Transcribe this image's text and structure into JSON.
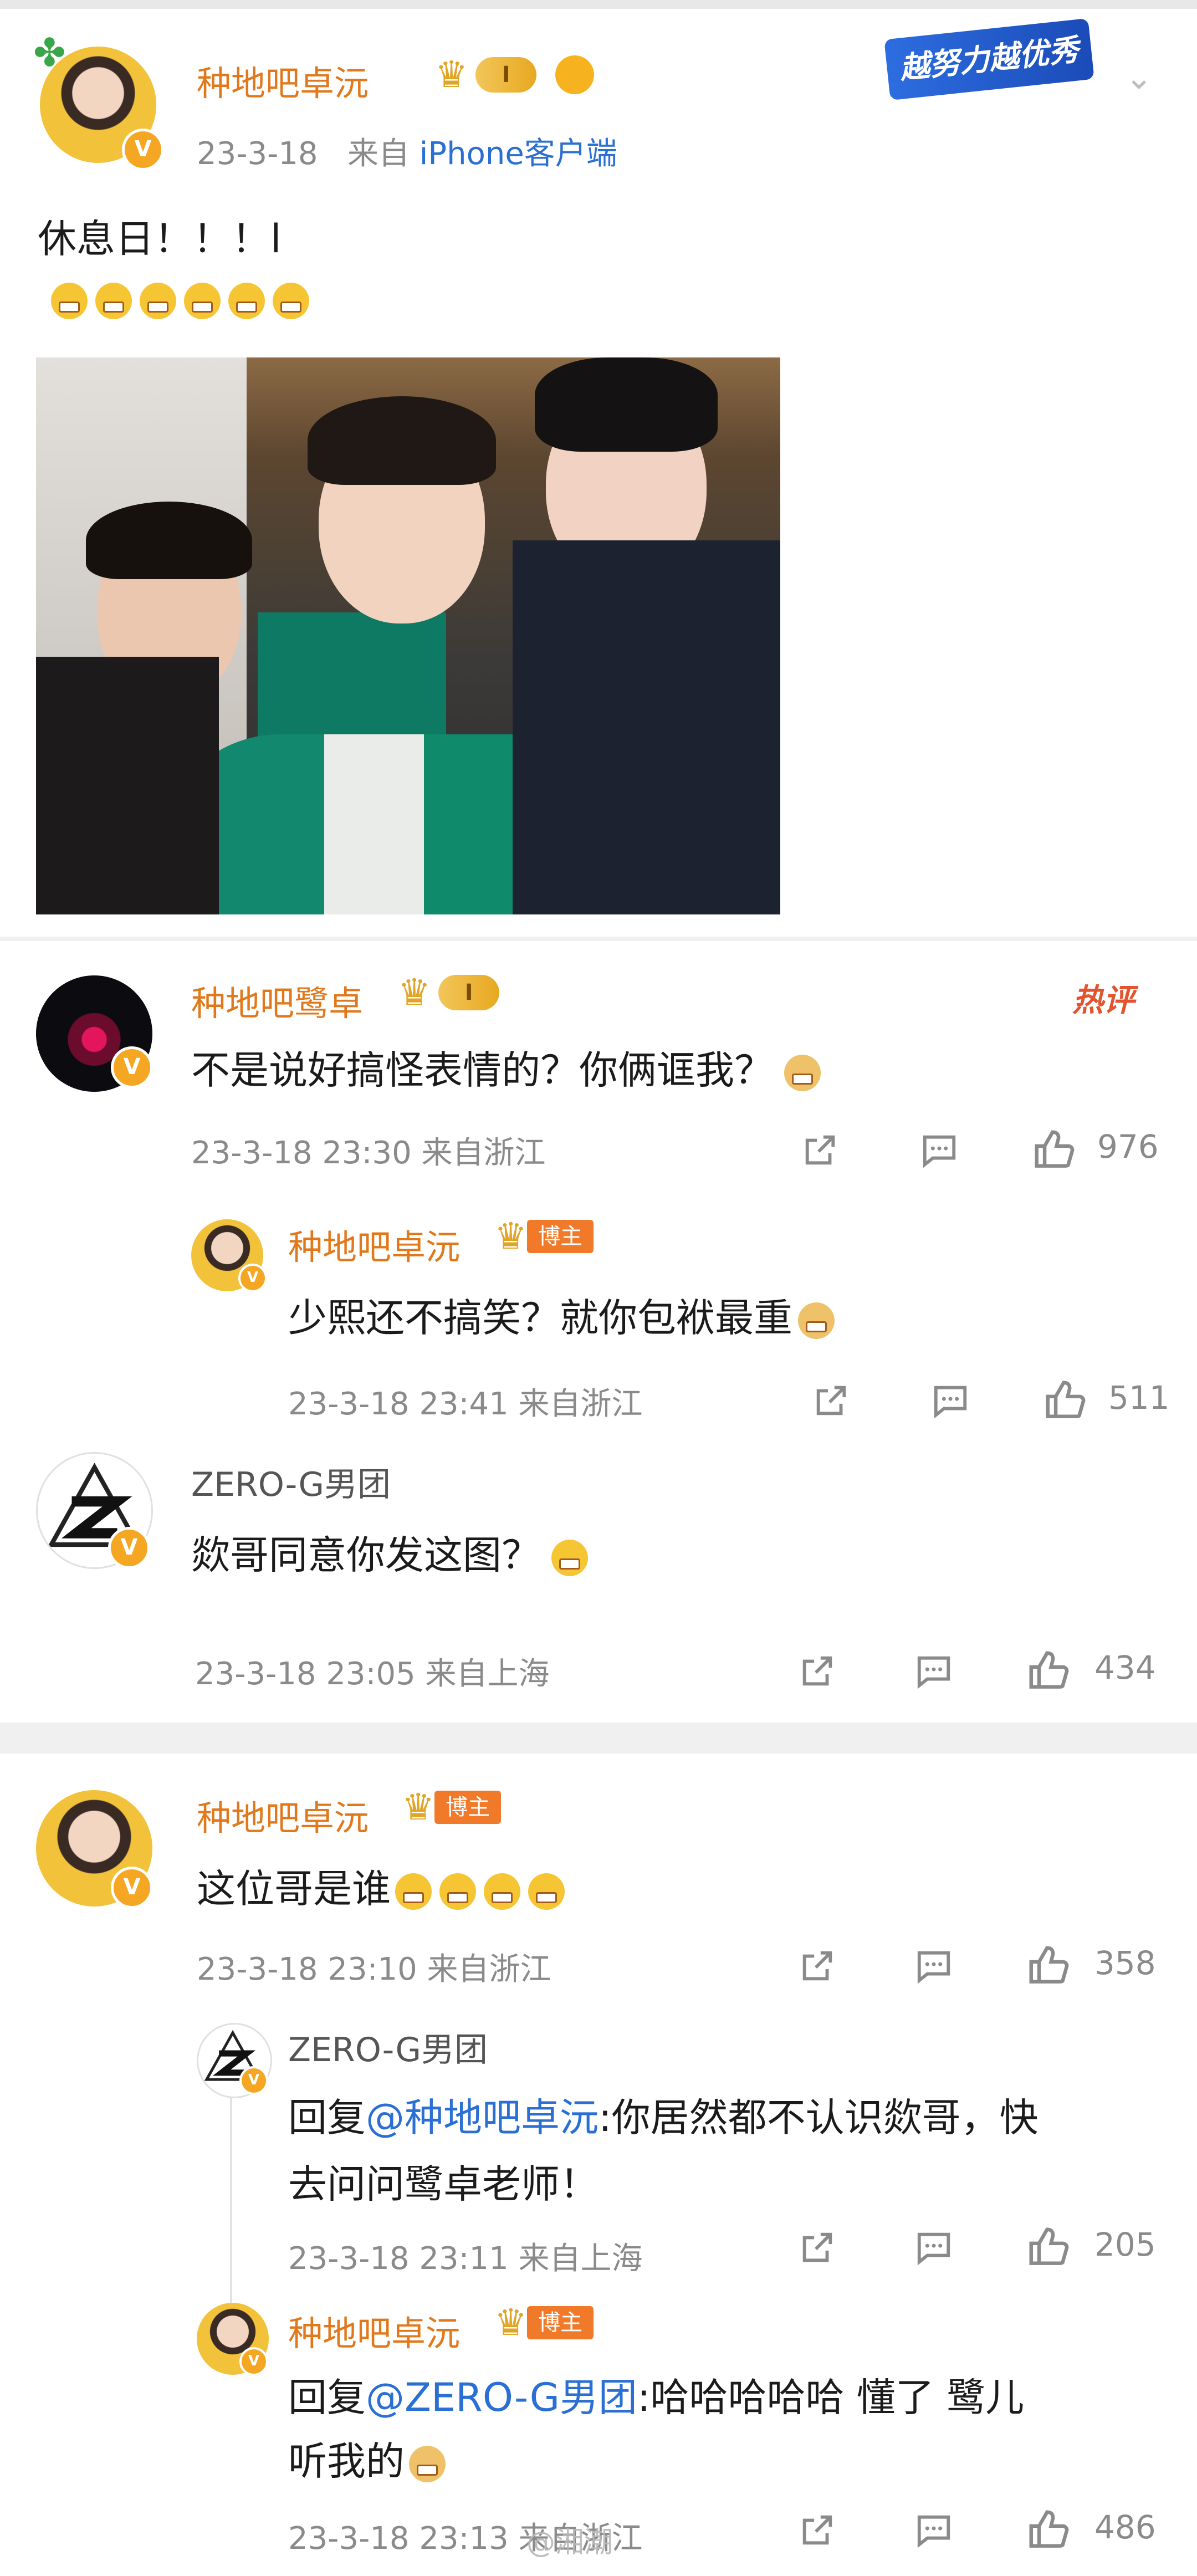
{
  "post": {
    "author": "种地吧卓沅",
    "level_badge": "I",
    "date": "23-3-18",
    "source_prefix": "来自",
    "source": "iPhone客户端",
    "text": "休息日！！！l",
    "emoji_count": 6,
    "slogan_badge": "越努力越优秀"
  },
  "comments": [
    {
      "author": "种地吧鹭卓",
      "level_badge": "I",
      "hot_label": "热评",
      "text": "不是说好搞怪表情的？你俩诓我？",
      "time": "23-3-18 23:30 来自浙江",
      "likes": "976",
      "reply": {
        "author": "种地吧卓沅",
        "tag": "博主",
        "text": "少熙还不搞笑？就你包袱最重",
        "time": "23-3-18 23:41 来自浙江",
        "likes": "511"
      }
    },
    {
      "author": "ZERO-G男团",
      "text": "欻哥同意你发这图？",
      "time": "23-3-18 23:05 来自上海",
      "likes": "434"
    },
    {
      "author": "种地吧卓沅",
      "tag": "博主",
      "text": "这位哥是谁",
      "time": "23-3-18 23:10 来自浙江",
      "likes": "358",
      "replies": [
        {
          "author": "ZERO-G男团",
          "prefix": "回复",
          "mention": "@种地吧卓沅",
          "text_line1": ":你居然都不认识欻哥，快",
          "text_line2": "去问问鹭卓老师！",
          "time": "23-3-18 23:11 来自上海",
          "likes": "205"
        },
        {
          "author": "种地吧卓沅",
          "tag": "博主",
          "prefix": "回复",
          "mention": "@ZERO-G男团",
          "text_line1": ":哈哈哈哈哈 懂了  鹭儿",
          "text_line2": "听我的",
          "time": "23-3-18 23:13 来自浙江",
          "likes": "486"
        }
      ]
    }
  ],
  "watermark": "@湘潮"
}
